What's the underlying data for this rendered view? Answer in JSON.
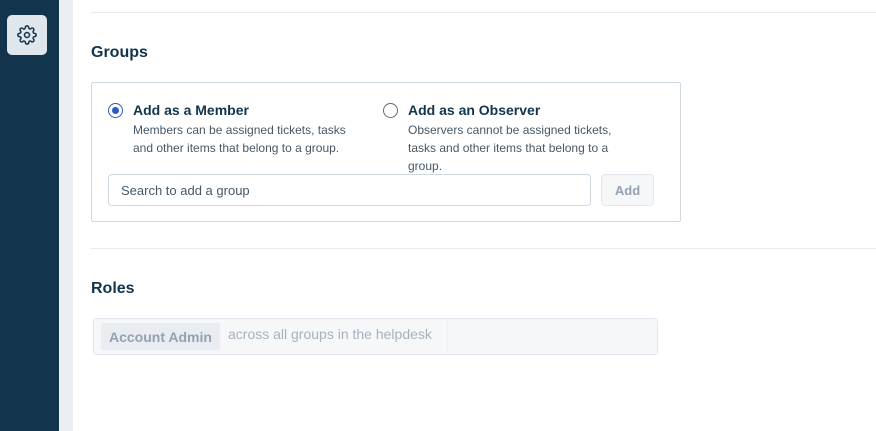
{
  "sidebar": {
    "settings_icon": "gear-icon"
  },
  "groups": {
    "title": "Groups",
    "options": [
      {
        "label": "Add as a Member",
        "description": "Members can be assigned tickets, tasks and other items that belong to a group.",
        "selected": true
      },
      {
        "label": "Add as an Observer",
        "description": "Observers cannot be assigned tickets, tasks and other items that belong to a group.",
        "selected": false
      }
    ],
    "search": {
      "placeholder": "Search to add a group",
      "value": ""
    },
    "add_label": "Add"
  },
  "roles": {
    "title": "Roles",
    "role_name": "Account Admin",
    "scope": "across all groups in the helpdesk"
  },
  "colors": {
    "sidebar_bg": "#12344d",
    "accent": "#2c5cc5",
    "heading": "#12344d"
  }
}
